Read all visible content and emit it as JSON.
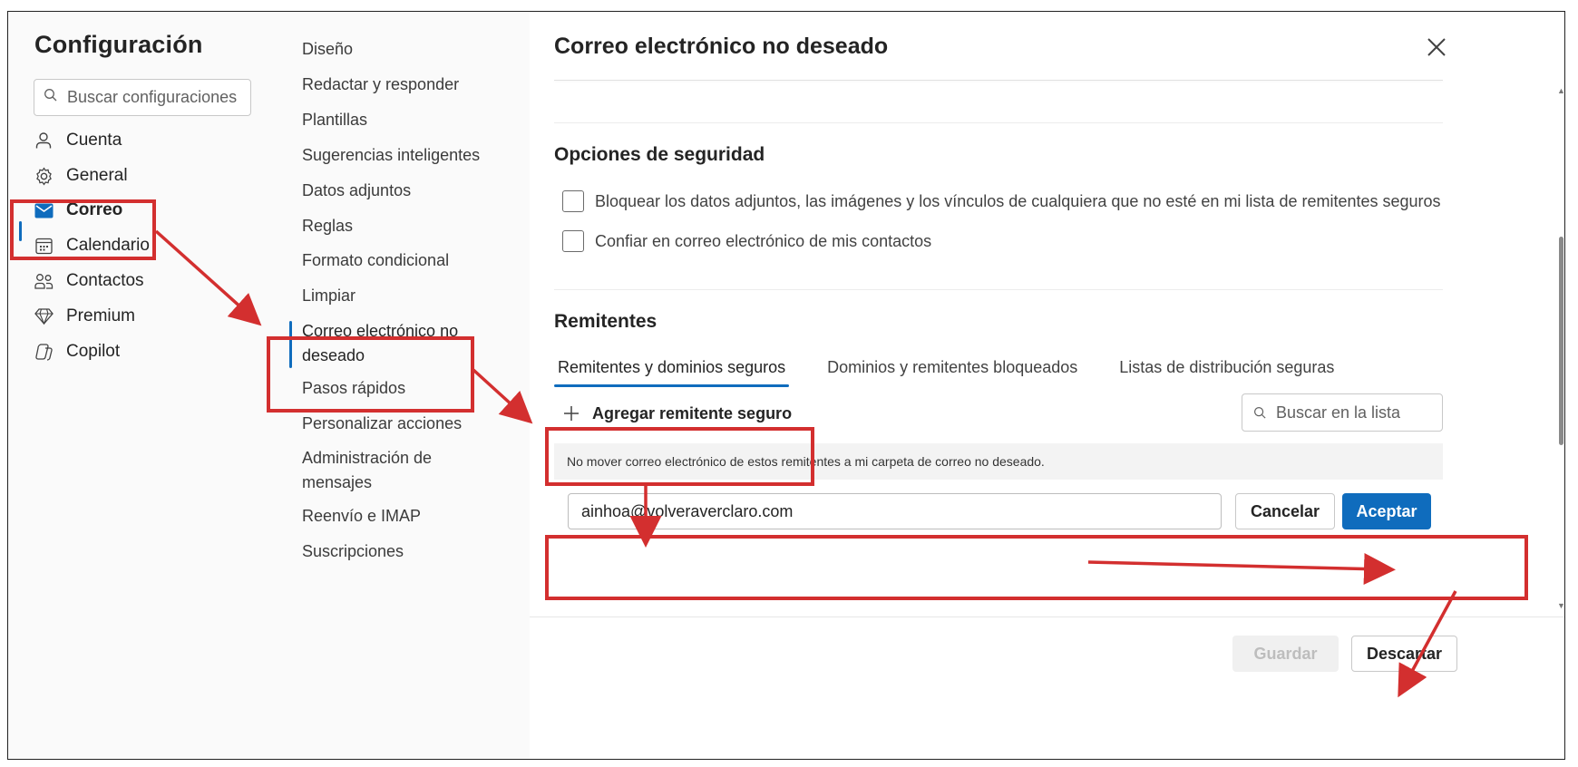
{
  "sidebar": {
    "title": "Configuración",
    "search_placeholder": "Buscar configuraciones",
    "items": [
      {
        "label": "Cuenta"
      },
      {
        "label": "General"
      },
      {
        "label": "Correo"
      },
      {
        "label": "Calendario"
      },
      {
        "label": "Contactos"
      },
      {
        "label": "Premium"
      },
      {
        "label": "Copilot"
      }
    ]
  },
  "mail_menu": {
    "items": [
      {
        "label": "Diseño"
      },
      {
        "label": "Redactar y responder"
      },
      {
        "label": "Plantillas"
      },
      {
        "label": "Sugerencias inteligentes"
      },
      {
        "label": "Datos adjuntos"
      },
      {
        "label": "Reglas"
      },
      {
        "label": "Formato condicional"
      },
      {
        "label": "Limpiar"
      },
      {
        "label": "Correo electrónico no deseado"
      },
      {
        "label": "Pasos rápidos"
      },
      {
        "label": "Personalizar acciones"
      },
      {
        "label": "Administración de mensajes"
      },
      {
        "label": "Reenvío e IMAP"
      },
      {
        "label": "Suscripciones"
      }
    ]
  },
  "panel": {
    "title": "Correo electrónico no deseado",
    "security": {
      "heading": "Opciones de seguridad",
      "options": [
        {
          "label": "Bloquear los datos adjuntos, las imágenes y los vínculos de cualquiera que no esté en mi lista de remitentes seguros",
          "checked": false
        },
        {
          "label": "Confiar en correo electrónico de mis contactos",
          "checked": false
        }
      ]
    },
    "senders": {
      "heading": "Remitentes",
      "tabs": [
        {
          "label": "Remitentes y dominios seguros",
          "active": true
        },
        {
          "label": "Dominios y remitentes bloqueados",
          "active": false
        },
        {
          "label": "Listas de distribución seguras",
          "active": false
        }
      ],
      "add_label": "Agregar remitente seguro",
      "list_search_placeholder": "Buscar en la lista",
      "info": "No mover correo electrónico de estos remitentes a mi carpeta de correo no deseado.",
      "email_value": "ainhoa@volveraverclaro.com",
      "cancel_label": "Cancelar",
      "accept_label": "Aceptar"
    },
    "footer": {
      "save_label": "Guardar",
      "discard_label": "Descartar"
    }
  },
  "colors": {
    "accent": "#0f6cbd",
    "annotation": "#d32f2f"
  }
}
